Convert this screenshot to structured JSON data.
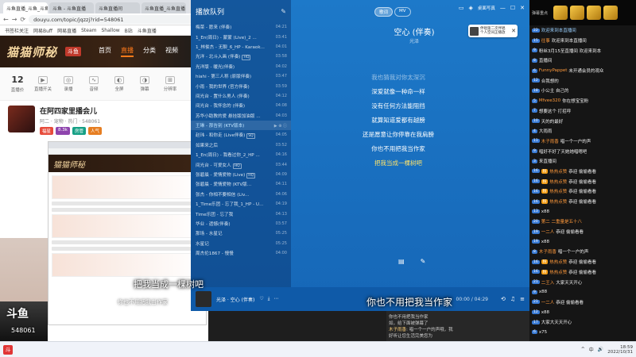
{
  "browser": {
    "tabs": [
      "斗鱼直播_斗鱼_斗鱼直播",
      "斗鱼 - 斗鱼直播",
      "斗鱼直播间",
      "斗鱼直播_斗鱼直播"
    ],
    "url": "douyu.com/topic/jqzzj?rid=548061",
    "bookmarks": [
      "书签栏关注",
      "网易Buff",
      "网易直播",
      "Steam",
      "Shallow",
      "B站",
      "斗鱼直播"
    ],
    "site_logo": "猫猫师秘",
    "site_badge": "斗鱼",
    "nav": [
      "首页",
      "直播",
      "分类",
      "视频"
    ],
    "nav_active": 1,
    "tools": [
      {
        "value": "12",
        "label": "直播价"
      },
      {
        "icon": "▶",
        "label": "直播开关"
      },
      {
        "icon": "◎",
        "label": "录播"
      },
      {
        "icon": "∿",
        "label": "音频"
      },
      {
        "icon": "◐",
        "label": "全屏"
      },
      {
        "icon": "◑",
        "label": "弹幕"
      },
      {
        "icon": "⊞",
        "label": "分辨率"
      }
    ],
    "room": {
      "title": "在阿四家里播会儿",
      "meta": "阿二 · 宠物 · 热门 · 548061",
      "tags": [
        {
          "text": "福星",
          "color": "#e74c3c"
        },
        {
          "text": "8.3k",
          "color": "#8e44ad"
        },
        {
          "text": "房管",
          "color": "#16a085"
        },
        {
          "text": "人气",
          "color": "#e67e22"
        }
      ]
    },
    "nested_logo": "猫猫师秘",
    "stream_logo": "斗鱼",
    "room_num": "548061"
  },
  "player": {
    "queue_title": "播放队列",
    "queue_edit": "✎",
    "queue": [
      {
        "name": "梅菜 - 愿来 (伴奏)",
        "dur": "04:21"
      },
      {
        "name": "1_En(周日) - 蒙蒙 (Live)_2 ...",
        "dur": "03:41"
      },
      {
        "name": "1_林俊杰 - 无聊_6_HP - Karaok...",
        "dur": "04:01"
      },
      {
        "name": "光洋 - 北斗入画 (伴奏)",
        "dur": "03:58",
        "tag": "HQ"
      },
      {
        "name": "光洋版 - 暖光(伴奏)",
        "dur": "04:02"
      },
      {
        "name": "hiahi - 第三人称 (原版伴奏)",
        "dur": "03:47"
      },
      {
        "name": "小雨 - 我的世界 (官方伴奏)",
        "dur": "03:59"
      },
      {
        "name": "间光台 - 置什么男人 (伴奏)",
        "dur": "04:12"
      },
      {
        "name": "间光台 - 我怀念的 (伴奏)",
        "dur": "04:08"
      },
      {
        "name": "苏华小助教的爱 悬挂版加油版 ...",
        "dur": "04:03"
      },
      {
        "name": "王琳 - 那告别 (KTV版本)",
        "dur": "03:55",
        "playing": true
      },
      {
        "name": "赵玮 - 和你走 (Live伴奏)",
        "dur": "04:05",
        "tag": "SQ"
      },
      {
        "name": "如果来之后",
        "dur": "03:52"
      },
      {
        "name": "1_En(周日) - 我看过你_2_HP ...",
        "dur": "04:16"
      },
      {
        "name": "间光台 - 可爱女人",
        "dur": "03:44",
        "tag": "HQ"
      },
      {
        "name": "张碧晨 - 爱情爱物 (Live)",
        "dur": "04:09",
        "tag": "HQ"
      },
      {
        "name": "张碧晨 - 爱情爱物 (KTV版...",
        "dur": "04:11"
      },
      {
        "name": "张杰 - 你相不要相信 (Liv...",
        "dur": "04:06"
      },
      {
        "name": "1_Time乐团 - 忘了我_1_HP - U...",
        "dur": "04:19"
      },
      {
        "name": "Time乐团 - 忘了我",
        "dur": "04:13"
      },
      {
        "name": "华业 - 遗憾(伴奏)",
        "dur": "03:57"
      },
      {
        "name": "那场 - 水星记",
        "dur": "05:25"
      },
      {
        "name": "水星记",
        "dur": "05:25"
      },
      {
        "name": "周杰伦1867 - 慢慢",
        "dur": "04:00"
      }
    ],
    "top_buttons": [
      "歌词",
      "MV"
    ],
    "top_active": 0,
    "window_controls": {
      "label": "桌面写真"
    },
    "song_title": "空心 (伴奏)",
    "song_artist": "光泽",
    "lyrics": [
      {
        "text": "我也猜我对你太深沉",
        "state": "dim"
      },
      {
        "text": "深爱就像一种命一样",
        "state": "normal"
      },
      {
        "text": "没有任何方法能阻挡",
        "state": "normal"
      },
      {
        "text": "就算知道爱都有越膀",
        "state": "normal"
      },
      {
        "text": "还是愿意让你停靠在我肩膀",
        "state": "normal"
      },
      {
        "text": "你也不用把我当作家",
        "state": "normal"
      },
      {
        "text": "把我当成一棵树吧",
        "state": "current"
      }
    ],
    "pane_icons": [
      "▤",
      "✎"
    ],
    "bottom": {
      "text": "光泽 · 空心 (伴奏)",
      "time": "00:00 / 04:29",
      "icons": [
        "♡",
        "⤓",
        "⋯"
      ],
      "right_icons": [
        "⟲",
        "♫",
        "≡"
      ]
    },
    "float_widget": {
      "line1": "伴唱第二次伴唱",
      "line2": "个人空间正播放"
    }
  },
  "chat": {
    "header_label": "弹幕重点",
    "messages": [
      {
        "lv": "22",
        "nick": "",
        "text": "欢迎来到本直播间",
        "sys": true
      },
      {
        "lv": "15",
        "nick": "往事",
        "text": "欢迎来到本直播间"
      },
      {
        "lv": "9",
        "nick": "",
        "text": "粉丝3月15至直播间 欢迎来到本"
      },
      {
        "lv": "8",
        "nick": "",
        "text": "直播间"
      },
      {
        "lv": "6",
        "nick": "FunnyPappet",
        "text": "未开通会员的观众"
      },
      {
        "lv": "12",
        "nick": "",
        "text": "合我想的"
      },
      {
        "lv": "18",
        "nick": "",
        "text": "小公主 自己的"
      },
      {
        "lv": "5",
        "nick": "Mfvee320",
        "text": "你在想宝宝粉"
      },
      {
        "lv": "7",
        "nick": "",
        "text": "想要这个 打招呼"
      },
      {
        "lv": "10",
        "nick": "",
        "text": "天的的最好"
      },
      {
        "lv": "4",
        "nick": "",
        "text": "大雨雨"
      },
      {
        "lv": "11",
        "nick": "木子雨香",
        "text": "唱一个一户的声"
      },
      {
        "lv": "9",
        "nick": "",
        "text": "唱好不好了天她她唱嗯吧"
      },
      {
        "lv": "3",
        "nick": "",
        "text": "来直播间"
      },
      {
        "lv": "16",
        "badge": "粉",
        "nick": "热热点赞",
        "text": "恭迎 偷偷看看"
      },
      {
        "lv": "16",
        "badge": "粉",
        "nick": "热热点赞",
        "text": "恭迎 偷偷看看"
      },
      {
        "lv": "16",
        "badge": "粉",
        "nick": "热热点赞",
        "text": "恭迎 偷偷看看"
      },
      {
        "lv": "16",
        "badge": "粉",
        "nick": "热热点赞",
        "text": "恭迎 偷偷看看"
      },
      {
        "lv": "13",
        "nick": "",
        "text": "x88"
      },
      {
        "lv": "20",
        "nick": "第二 二重量是五十八",
        "text": ""
      },
      {
        "lv": "19",
        "nick": "一二人",
        "text": "恭迎 偷偷看看"
      },
      {
        "lv": "19",
        "nick": "",
        "text": "x88"
      },
      {
        "lv": "8",
        "nick": "木子雨香",
        "text": "唱一个一户的声"
      },
      {
        "lv": "16",
        "badge": "粉",
        "nick": "热热点赞",
        "text": "恭迎 偷偷看看"
      },
      {
        "lv": "16",
        "badge": "粉",
        "nick": "热热点赞",
        "text": "恭迎 偷偷看看"
      },
      {
        "lv": "21",
        "nick": "二王入",
        "text": "大家天天开心"
      },
      {
        "lv": "9",
        "nick": "",
        "text": "x88"
      },
      {
        "lv": "21",
        "nick": "一二人",
        "text": "恭迎 偷偷看看"
      },
      {
        "lv": "12",
        "nick": "",
        "text": "x88"
      },
      {
        "lv": "17",
        "nick": "",
        "text": "大家大天天开心"
      },
      {
        "lv": "6",
        "nick": "",
        "text": "x75"
      }
    ]
  },
  "subtitles": {
    "main": "你也不用把我当作家",
    "left": "把我当成一棵树吧",
    "left2": "你也不用把我当作家"
  },
  "notice": {
    "line1": "你也不用把我当作家",
    "line2": "如，给下面被弹幕了",
    "line3_hl": "木子雨香",
    "line3": ": 唱一个一户的声哦，我",
    "line4": "好听让您生活完美您为"
  },
  "taskbar": {
    "app_icon": "斗",
    "tray_icons": [
      "^",
      "中",
      "🔊"
    ],
    "time": "18:59",
    "date": "2022/10/31"
  }
}
